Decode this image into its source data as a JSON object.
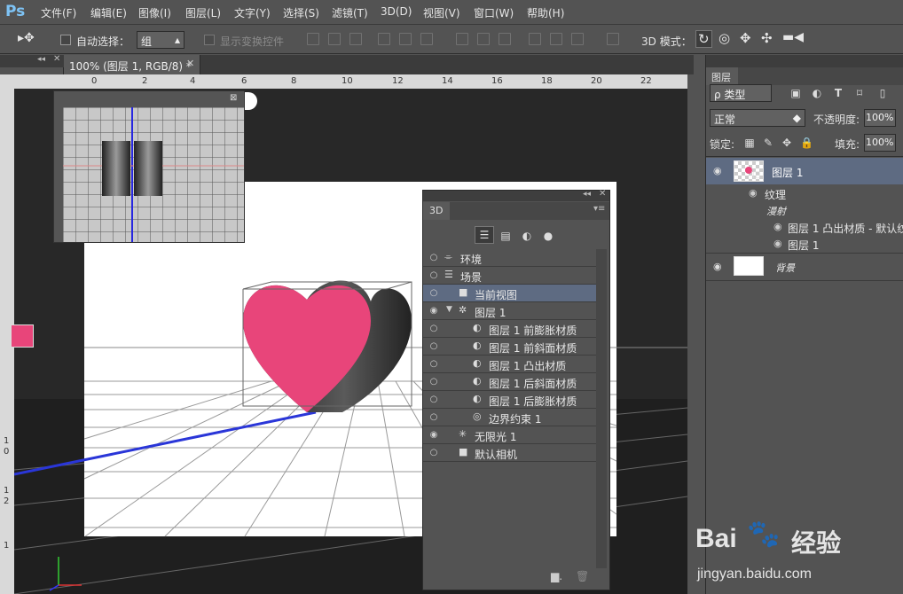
{
  "app": {
    "logo": "Ps"
  },
  "menu": [
    "文件(F)",
    "编辑(E)",
    "图像(I)",
    "图层(L)",
    "文字(Y)",
    "选择(S)",
    "滤镜(T)",
    "3D(D)",
    "视图(V)",
    "窗口(W)",
    "帮助(H)"
  ],
  "options": {
    "auto_select_label": "自动选择：",
    "auto_select_value": "组",
    "show_transform_label": "显示变换控件",
    "mode3d_label": "3D 模式："
  },
  "document": {
    "tab_title": "100% (图层 1, RGB/8) *",
    "ruler_ticks": [
      "0",
      "2",
      "4",
      "6",
      "8",
      "10",
      "12",
      "14",
      "16",
      "18",
      "20",
      "22"
    ],
    "ruler_left_ticks": [
      "1",
      "0",
      "1",
      "2",
      "1"
    ]
  },
  "panel3d": {
    "tab": "3D",
    "rows": [
      {
        "label": "环境",
        "indent": 0,
        "eye": false,
        "icon": "environment-icon",
        "selected": false,
        "arrow": false
      },
      {
        "label": "场景",
        "indent": 0,
        "eye": false,
        "icon": "scene-icon",
        "selected": false,
        "arrow": false
      },
      {
        "label": "当前视图",
        "indent": 1,
        "eye": false,
        "icon": "camera-icon",
        "selected": true,
        "arrow": false
      },
      {
        "label": "图层 1",
        "indent": 1,
        "eye": true,
        "icon": "mesh-icon",
        "selected": false,
        "arrow": true
      },
      {
        "label": "图层 1 前膨胀材质",
        "indent": 2,
        "eye": false,
        "icon": "material-icon",
        "selected": false,
        "arrow": false
      },
      {
        "label": "图层 1 前斜面材质",
        "indent": 2,
        "eye": false,
        "icon": "material-icon",
        "selected": false,
        "arrow": false
      },
      {
        "label": "图层 1 凸出材质",
        "indent": 2,
        "eye": false,
        "icon": "material-icon",
        "selected": false,
        "arrow": false
      },
      {
        "label": "图层 1 后斜面材质",
        "indent": 2,
        "eye": false,
        "icon": "material-icon",
        "selected": false,
        "arrow": false
      },
      {
        "label": "图层 1 后膨胀材质",
        "indent": 2,
        "eye": false,
        "icon": "material-icon",
        "selected": false,
        "arrow": false
      },
      {
        "label": "边界约束 1",
        "indent": 2,
        "eye": false,
        "icon": "constraint-icon",
        "selected": false,
        "arrow": false
      },
      {
        "label": "无限光 1",
        "indent": 1,
        "eye": true,
        "icon": "light-icon",
        "selected": false,
        "arrow": false
      },
      {
        "label": "默认相机",
        "indent": 1,
        "eye": false,
        "icon": "camera-icon",
        "selected": false,
        "arrow": false
      }
    ]
  },
  "layers": {
    "tab": "图层",
    "filter": "ρ 类型",
    "blend": "正常",
    "opacity_label": "不透明度:",
    "opacity_value": "100%",
    "lock_label": "锁定:",
    "fill_label": "填充:",
    "fill_value": "100%",
    "layer1": "图层 1",
    "texture": "纹理",
    "diffuse": "漫射",
    "sub1": "图层 1 凸出材质 - 默认纹",
    "sub2": "图层 1",
    "background": "背景"
  },
  "watermark": {
    "brand": "Bai",
    "brand2": "经验",
    "url": "jingyan.baidu.com"
  },
  "colors": {
    "foreground": "#e8457a",
    "background": "#ffffff",
    "accent": "#7ec3f5"
  }
}
